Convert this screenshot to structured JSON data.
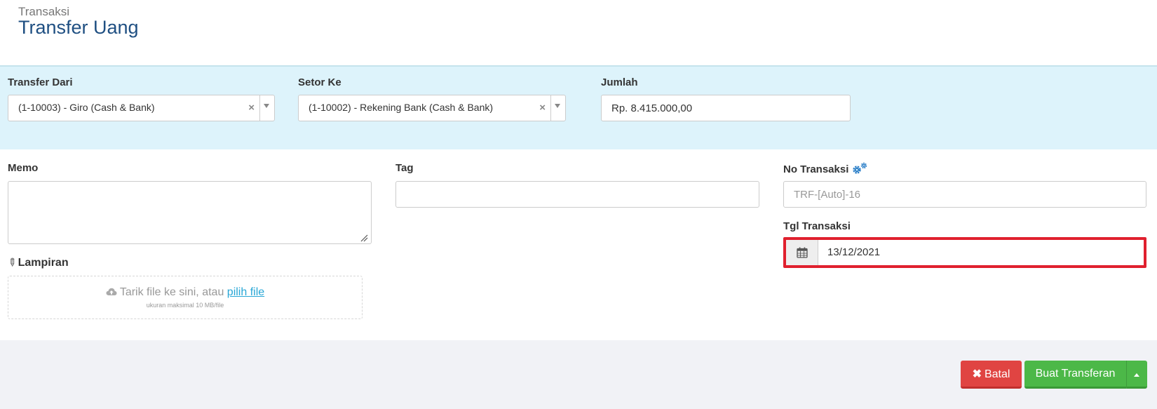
{
  "header": {
    "breadcrumb": "Transaksi",
    "title": "Transfer Uang"
  },
  "transfer": {
    "from_label": "Transfer Dari",
    "from_value": "(1-10003) - Giro (Cash & Bank)",
    "to_label": "Setor Ke",
    "to_value": "(1-10002) - Rekening Bank (Cash & Bank)",
    "amount_label": "Jumlah",
    "amount_value": "Rp. 8.415.000,00"
  },
  "memo": {
    "label": "Memo",
    "value": ""
  },
  "tag": {
    "label": "Tag",
    "value": ""
  },
  "attachment": {
    "label": "Lampiran",
    "drop_text": "Tarik file ke sini, atau",
    "link_text": "pilih file",
    "size_hint": "ukuran maksimal 10 MB/file"
  },
  "transaction_no": {
    "label": "No Transaksi",
    "placeholder": "TRF-[Auto]-16"
  },
  "transaction_date": {
    "label": "Tgl Transaksi",
    "value": "13/12/2021"
  },
  "actions": {
    "cancel_icon": "✖",
    "cancel_label": "Batal",
    "submit_label": "Buat Transferan"
  },
  "icons": {
    "clear": "×",
    "clip": "✎",
    "cloud": "cloud-upload-icon",
    "gear": "gear-icon",
    "calendar": "calendar-icon"
  },
  "colors": {
    "title": "#1f4f82",
    "top_panel": "#ddf3fb",
    "highlight_border": "#e0202e",
    "cancel": "#e04442",
    "submit": "#4cb848",
    "link": "#29a7d6",
    "gear": "#2c7fc8"
  }
}
